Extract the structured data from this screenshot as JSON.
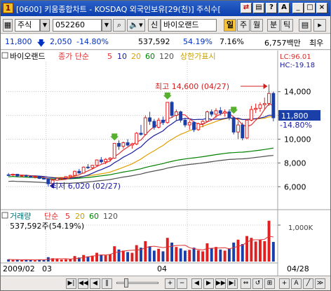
{
  "window": {
    "title": "[0600] 키움종합차트 - KOSDAQ 외국인보유[29(천)] 주식수[",
    "app_icon": "1"
  },
  "toolbar": {
    "market": "주식",
    "code": "052260",
    "stock_name": "바이오랜드",
    "period_buttons": [
      "일",
      "주",
      "월",
      "분",
      "틱"
    ],
    "active_period": "일",
    "sin_label": "신"
  },
  "info": {
    "price": "11,800",
    "change": "2,050",
    "change_pct": "-14.80%",
    "volume": "537,592",
    "volume_ratio": "54.19%",
    "turnover": "7.16%",
    "amount": "6,757백만",
    "extra": "최우"
  },
  "chart_data": {
    "type": "candlestick",
    "title": "바이오랜드",
    "legend": [
      "종가 단순",
      "5",
      "10",
      "20",
      "60",
      "120",
      "상한가표시"
    ],
    "ma_colors": {
      "5": "#e03030",
      "10": "#1a1aa0",
      "20": "#e0a000",
      "60": "#008000",
      "120": "#505050"
    },
    "price_axis_labels": [
      "14,000",
      "12,000",
      "10,000",
      "8,000",
      "6,000"
    ],
    "price_axis_values": [
      14000,
      12000,
      10000,
      8000,
      6000
    ],
    "ylim": [
      4600,
      16400
    ],
    "lc": "LC:96.01",
    "hc": "HC:-19.18",
    "current_price_label": "11,800",
    "current_change_label": "-14.80%",
    "high_annotation": "최고 14,600 (04/27)",
    "low_annotation": "최저 6,020 (02/27)",
    "high_value": 14600,
    "low_value": 6020,
    "limit_up_days": [
      24,
      36,
      51
    ],
    "candles": [
      {
        "o": 7000,
        "h": 7150,
        "l": 6880,
        "c": 6980
      },
      {
        "o": 6980,
        "h": 7100,
        "l": 6900,
        "c": 7050
      },
      {
        "o": 7050,
        "h": 7080,
        "l": 6850,
        "c": 6900
      },
      {
        "o": 6900,
        "h": 7000,
        "l": 6800,
        "c": 6950
      },
      {
        "o": 6950,
        "h": 7020,
        "l": 6850,
        "c": 6880
      },
      {
        "o": 6880,
        "h": 6950,
        "l": 6750,
        "c": 6800
      },
      {
        "o": 6800,
        "h": 6900,
        "l": 6700,
        "c": 6850
      },
      {
        "o": 6850,
        "h": 6900,
        "l": 6650,
        "c": 6700
      },
      {
        "o": 6700,
        "h": 6780,
        "l": 6600,
        "c": 6650
      },
      {
        "o": 6650,
        "h": 6700,
        "l": 6020,
        "c": 6250
      },
      {
        "o": 6250,
        "h": 6600,
        "l": 6200,
        "c": 6550
      },
      {
        "o": 6550,
        "h": 6750,
        "l": 6500,
        "c": 6700
      },
      {
        "o": 6700,
        "h": 6800,
        "l": 6600,
        "c": 6750
      },
      {
        "o": 6750,
        "h": 6900,
        "l": 6700,
        "c": 6850
      },
      {
        "o": 6850,
        "h": 7000,
        "l": 6800,
        "c": 6950
      },
      {
        "o": 6950,
        "h": 7350,
        "l": 6900,
        "c": 7300
      },
      {
        "o": 7300,
        "h": 7500,
        "l": 7100,
        "c": 7150
      },
      {
        "o": 7150,
        "h": 7700,
        "l": 7100,
        "c": 7650
      },
      {
        "o": 7650,
        "h": 7900,
        "l": 7500,
        "c": 7600
      },
      {
        "o": 7600,
        "h": 7850,
        "l": 7450,
        "c": 7800
      },
      {
        "o": 7800,
        "h": 8300,
        "l": 7700,
        "c": 8250
      },
      {
        "o": 8250,
        "h": 8500,
        "l": 7950,
        "c": 8100
      },
      {
        "o": 8100,
        "h": 8400,
        "l": 7900,
        "c": 8300
      },
      {
        "o": 8300,
        "h": 8500,
        "l": 8100,
        "c": 8400
      },
      {
        "o": 8400,
        "h": 9650,
        "l": 8350,
        "c": 9650
      },
      {
        "o": 9650,
        "h": 9900,
        "l": 9100,
        "c": 9400
      },
      {
        "o": 9400,
        "h": 9800,
        "l": 9200,
        "c": 9700
      },
      {
        "o": 9700,
        "h": 10000,
        "l": 9400,
        "c": 9500
      },
      {
        "o": 9500,
        "h": 9700,
        "l": 9200,
        "c": 9600
      },
      {
        "o": 9600,
        "h": 10600,
        "l": 9500,
        "c": 10500
      },
      {
        "o": 10500,
        "h": 11200,
        "l": 10300,
        "c": 10400
      },
      {
        "o": 10400,
        "h": 12000,
        "l": 10300,
        "c": 11800
      },
      {
        "o": 11800,
        "h": 12300,
        "l": 11200,
        "c": 11500
      },
      {
        "o": 11500,
        "h": 11700,
        "l": 10800,
        "c": 11000
      },
      {
        "o": 11000,
        "h": 11800,
        "l": 10900,
        "c": 11600
      },
      {
        "o": 11600,
        "h": 11900,
        "l": 11200,
        "c": 11400
      },
      {
        "o": 11400,
        "h": 13100,
        "l": 11300,
        "c": 13100
      },
      {
        "o": 13100,
        "h": 13200,
        "l": 11800,
        "c": 12000
      },
      {
        "o": 12000,
        "h": 12500,
        "l": 11600,
        "c": 12300
      },
      {
        "o": 12300,
        "h": 12400,
        "l": 11400,
        "c": 11600
      },
      {
        "o": 11600,
        "h": 11800,
        "l": 11000,
        "c": 11200
      },
      {
        "o": 11200,
        "h": 11600,
        "l": 10800,
        "c": 11400
      },
      {
        "o": 11400,
        "h": 11500,
        "l": 10600,
        "c": 10800
      },
      {
        "o": 10800,
        "h": 11400,
        "l": 10700,
        "c": 11300
      },
      {
        "o": 11300,
        "h": 11600,
        "l": 11000,
        "c": 11500
      },
      {
        "o": 11500,
        "h": 12400,
        "l": 11400,
        "c": 12300
      },
      {
        "o": 12300,
        "h": 12500,
        "l": 11900,
        "c": 12100
      },
      {
        "o": 12100,
        "h": 12600,
        "l": 11800,
        "c": 12400
      },
      {
        "o": 12400,
        "h": 12700,
        "l": 12000,
        "c": 12200
      },
      {
        "o": 12200,
        "h": 12500,
        "l": 11900,
        "c": 12300
      },
      {
        "o": 12300,
        "h": 12500,
        "l": 11600,
        "c": 11800
      },
      {
        "o": 11800,
        "h": 11900,
        "l": 10400,
        "c": 10600
      },
      {
        "o": 10600,
        "h": 11500,
        "l": 10000,
        "c": 11200
      },
      {
        "o": 11200,
        "h": 11400,
        "l": 9900,
        "c": 10100
      },
      {
        "o": 10100,
        "h": 11700,
        "l": 10000,
        "c": 11600
      },
      {
        "o": 11600,
        "h": 12800,
        "l": 11500,
        "c": 12500
      },
      {
        "o": 12500,
        "h": 13000,
        "l": 12200,
        "c": 12600
      },
      {
        "o": 12600,
        "h": 13100,
        "l": 12300,
        "c": 12900
      },
      {
        "o": 12900,
        "h": 13500,
        "l": 12500,
        "c": 13000
      },
      {
        "o": 13000,
        "h": 14600,
        "l": 12800,
        "c": 13850
      },
      {
        "o": 13850,
        "h": 14000,
        "l": 11500,
        "c": 11800
      }
    ],
    "volume": {
      "title": "거래량",
      "legend": [
        "단순",
        "5",
        "20",
        "60",
        "120"
      ],
      "current_label": "537,592주(54.19%)",
      "axis_label": "1,000K",
      "axis_value": 1000000,
      "max": 1250000,
      "values": [
        60000,
        45000,
        50000,
        40000,
        55000,
        50000,
        35000,
        60000,
        45000,
        120000,
        90000,
        70000,
        55000,
        60000,
        65000,
        150000,
        110000,
        180000,
        140000,
        160000,
        240000,
        190000,
        170000,
        200000,
        420000,
        330000,
        300000,
        260000,
        240000,
        450000,
        380000,
        560000,
        420000,
        300000,
        350000,
        280000,
        650000,
        520000,
        400000,
        360000,
        300000,
        320000,
        380000,
        310000,
        280000,
        500000,
        360000,
        400000,
        330000,
        300000,
        350000,
        520000,
        600000,
        480000,
        700000,
        650000,
        550000,
        600000,
        560000,
        1120000,
        537592
      ]
    },
    "x_labels": [
      "2009/02",
      "03",
      "04",
      "04/28"
    ]
  }
}
